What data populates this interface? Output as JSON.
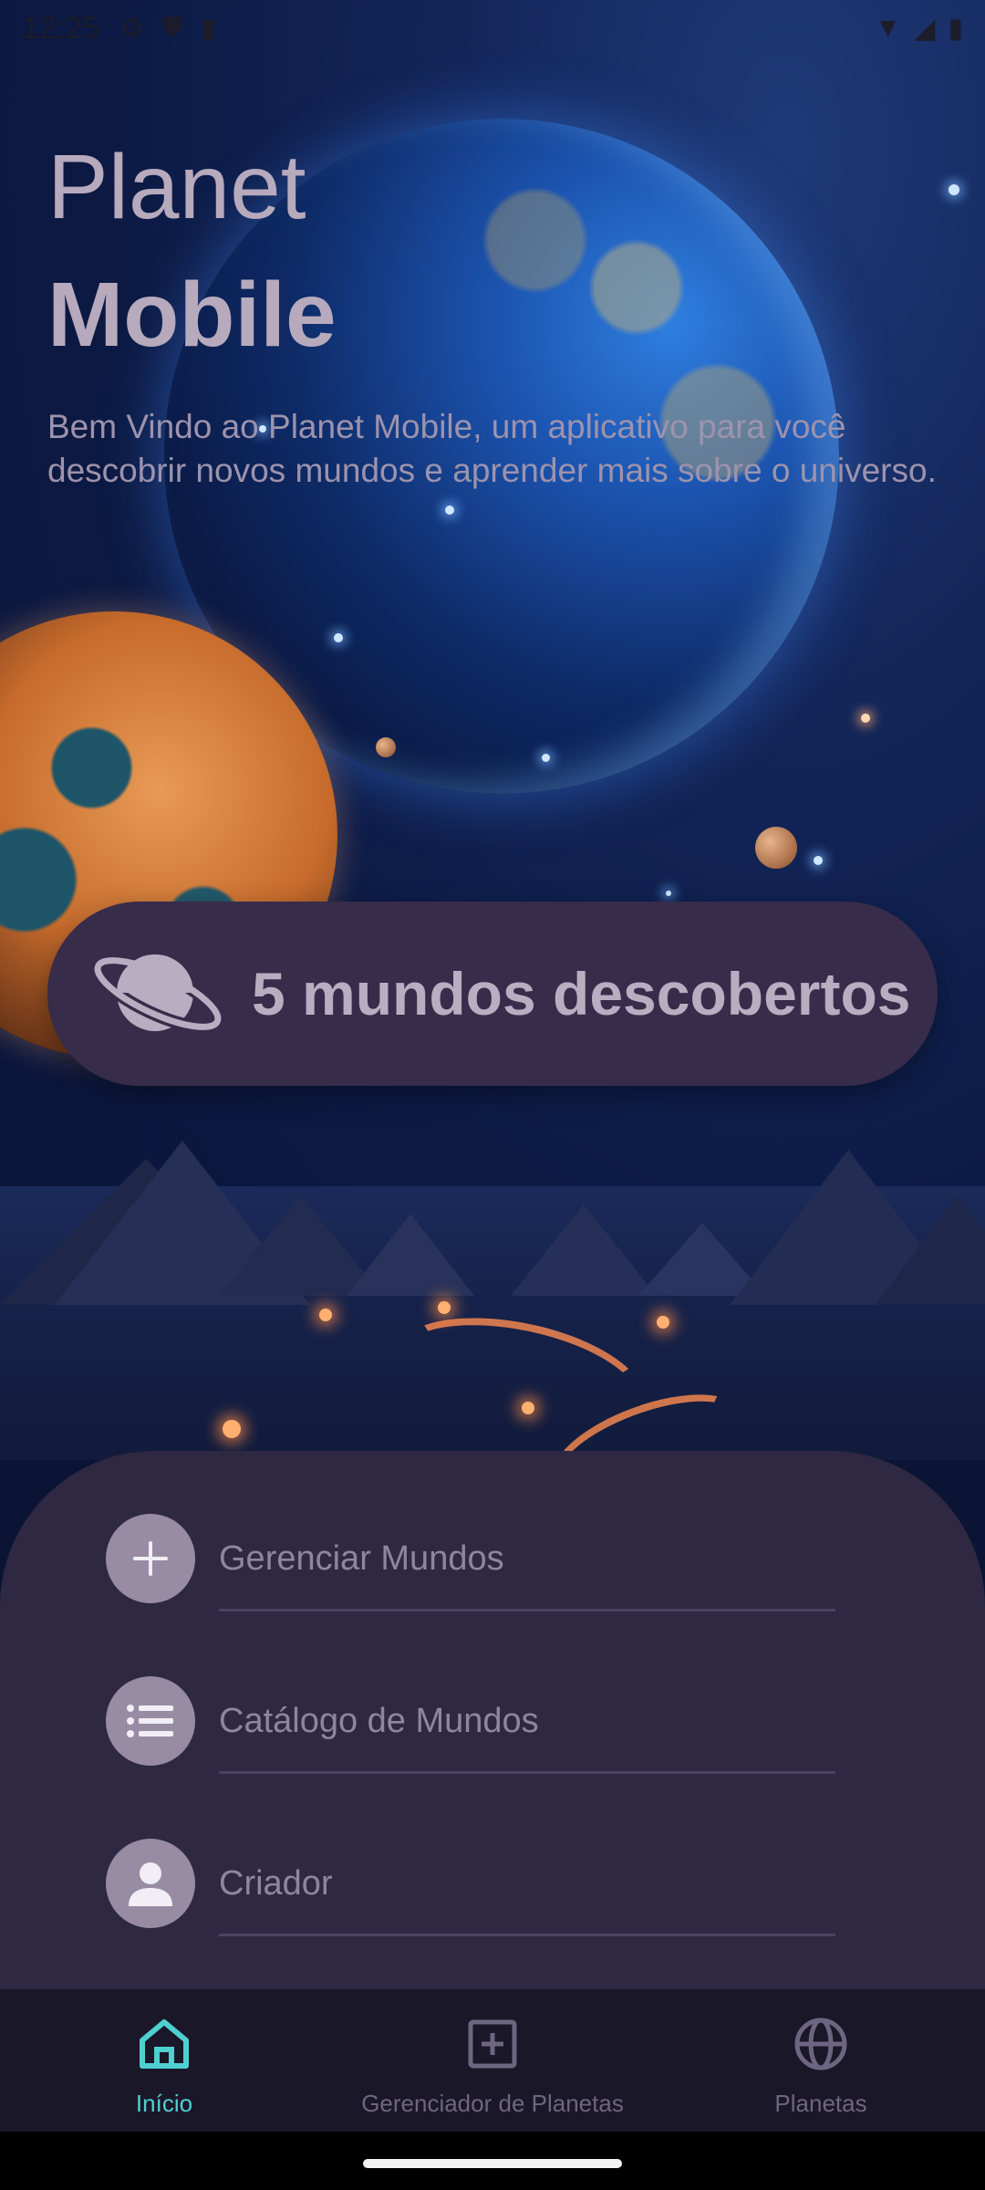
{
  "status_bar": {
    "time": "12:25",
    "icons_left": [
      "gear-icon",
      "shield-icon",
      "sim-card-icon"
    ],
    "icons_right": [
      "wifi-icon",
      "signal-icon",
      "battery-icon"
    ]
  },
  "hero": {
    "title_line1": "Planet",
    "title_line2": "Mobile",
    "intro": "Bem Vindo ao Planet Mobile, um aplicativo para você descobrir novos mundos e aprender mais sobre o universo."
  },
  "counter": {
    "icon": "planet-icon",
    "text": "5 mundos descobertos"
  },
  "menu": {
    "items": [
      {
        "label": "Gerenciar Mundos",
        "icon": "plus-icon"
      },
      {
        "label": "Catálogo de Mundos",
        "icon": "list-icon"
      },
      {
        "label": "Criador",
        "icon": "person-icon"
      }
    ]
  },
  "bottom_nav": {
    "items": [
      {
        "label": "Início",
        "icon": "home-icon",
        "active": true
      },
      {
        "label": "Gerenciador de Planetas",
        "icon": "add-box-icon",
        "active": false
      },
      {
        "label": "Planetas",
        "icon": "globe-icon",
        "active": false
      }
    ]
  },
  "colors": {
    "accent": "#4fd0d0",
    "sheet": "#2f2842",
    "pill": "#372c4a",
    "nav_background": "#1a1729"
  }
}
